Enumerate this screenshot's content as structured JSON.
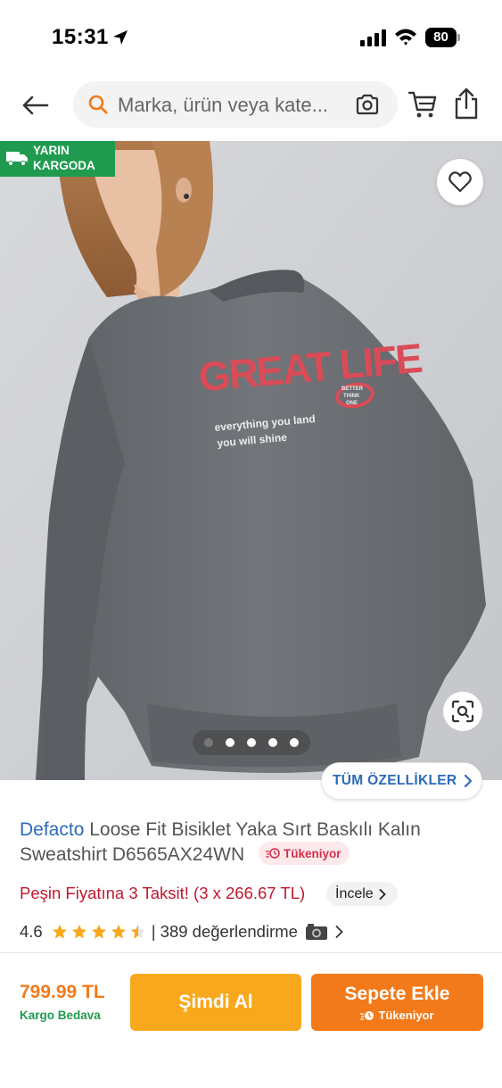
{
  "status_bar": {
    "time": "15:31",
    "battery": "80"
  },
  "search": {
    "placeholder": "Marka, ürün veya kate..."
  },
  "image": {
    "cargo_badge_line1": "YARIN",
    "cargo_badge_line2": "KARGODA",
    "print_headline": "GREAT LIFE",
    "print_line1": "everything you land",
    "print_line2": "you will shine",
    "print_badge": "BETTER THINK ONE",
    "slide_count": 5,
    "active_slide": 1
  },
  "specs_button": {
    "label": "TÜM ÖZELLİKLER"
  },
  "product": {
    "brand": "Defacto",
    "title": "Loose Fit Bisiklet Yaka Sırt Baskılı Kalın Sweatshirt D6565AX24WN",
    "stock_badge": "Tükeniyor",
    "installment": "Peşin Fiyatına 3 Taksit! (3 x 266.67 TL)",
    "incele_label": "İncele",
    "rating": "4.6",
    "rating_stars": 4.5,
    "review_text": "| 389 değerlendirme"
  },
  "bottom_bar": {
    "price": "799.99 TL",
    "free_cargo": "Kargo Bedava",
    "buy_now": "Şimdi Al",
    "add_to_cart": "Sepete Ekle",
    "add_to_cart_sub": "Tükeniyor"
  },
  "colors": {
    "brand_orange": "#f27a1a",
    "buy_now_yellow": "#f8a81c",
    "cargo_green": "#1f9b4f",
    "link_blue": "#2b6bb8",
    "installment_red": "#c0182d",
    "star_gold": "#f8a81c",
    "sweatshirt_gray": "#6d7074",
    "print_red": "#d94c57"
  }
}
